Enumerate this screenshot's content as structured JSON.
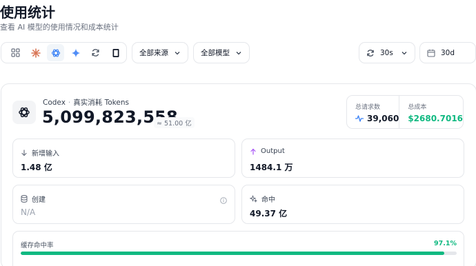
{
  "header": {
    "title": "使用统计",
    "subtitle": "查看 AI 模型的使用情况和成本统计"
  },
  "toolbar": {
    "providers": [
      {
        "name": "all-providers-icon"
      },
      {
        "name": "claude-icon"
      },
      {
        "name": "openai-icon"
      },
      {
        "name": "gemini-icon"
      },
      {
        "name": "sync-provider-icon"
      },
      {
        "name": "device-icon"
      }
    ],
    "active_provider": 2,
    "source_select": "全部来源",
    "model_select": "全部模型",
    "refresh_interval": "30s",
    "time_range": "30d"
  },
  "overview": {
    "app_name": "Codex",
    "separator": "·",
    "metric_label": "真实消耗 Tokens",
    "total_tokens": "5,099,823,558",
    "approx": "≈ 51.00 亿",
    "requests_label": "总请求数",
    "requests_value": "39,060",
    "cost_label": "总成本",
    "cost_value": "$2680.7016"
  },
  "stats": {
    "input_label": "新增输入",
    "input_value": "1.48 亿",
    "output_label": "Output",
    "output_value": "1484.1 万",
    "create_label": "创建",
    "create_value": "N/A",
    "hit_label": "命中",
    "hit_value": "49.37 亿"
  },
  "cache": {
    "label": "缓存命中率",
    "percent_text": "97.1%",
    "fraction": 0.971
  },
  "colors": {
    "accent_green": "#10b981",
    "accent_blue": "#3b82f6",
    "output_purple": "#a855f7"
  }
}
